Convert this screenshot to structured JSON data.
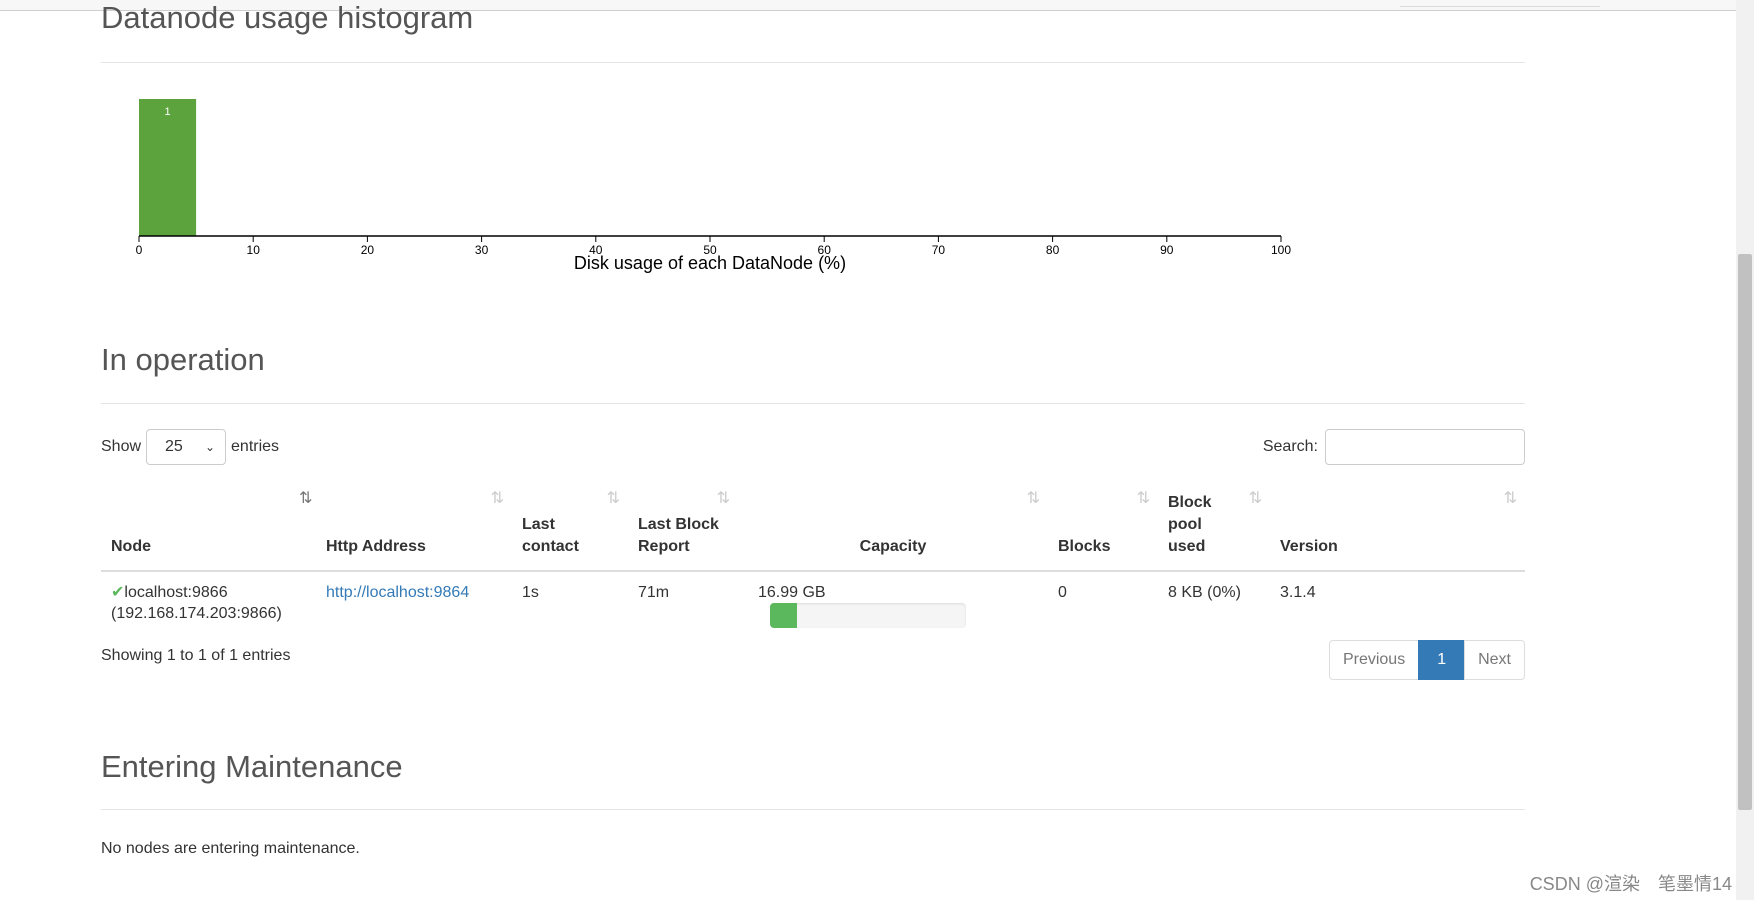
{
  "histogram": {
    "title": "Datanode usage histogram",
    "chart_data": {
      "type": "bar",
      "title": "",
      "xlabel": "Disk usage of each DataNode (%)",
      "ylabel": "",
      "xlim": [
        0,
        100
      ],
      "x_ticks": [
        "0",
        "10",
        "20",
        "30",
        "40",
        "50",
        "60",
        "70",
        "80",
        "90",
        "100"
      ],
      "bins": [
        {
          "x0": 0,
          "x1": 5,
          "count": 1
        }
      ],
      "bar_color": "#5ca33e",
      "grid": false
    }
  },
  "in_operation": {
    "title": "In operation",
    "show_label": "Show",
    "entries_label": "entries",
    "page_size": "25",
    "search_label": "Search:",
    "search_value": "",
    "columns": [
      "Node",
      "Http Address",
      "Last contact",
      "Last Block Report",
      "Capacity",
      "Blocks",
      "Block pool used",
      "Version"
    ],
    "rows": [
      {
        "node_name": "localhost:9866",
        "node_addr": "(192.168.174.203:9866)",
        "http": "http://localhost:9864",
        "last_contact": "1s",
        "last_block_report": "71m",
        "capacity_text": "16.99 GB",
        "capacity_used_fraction": 0.14,
        "blocks": "0",
        "block_pool_used": "8 KB (0%)",
        "version": "3.1.4"
      }
    ],
    "info": "Showing 1 to 1 of 1 entries",
    "pager": {
      "previous": "Previous",
      "current": "1",
      "next": "Next"
    }
  },
  "maintenance": {
    "title": "Entering Maintenance",
    "message": "No nodes are entering maintenance."
  },
  "watermark": "CSDN @渲染　笔墨情14",
  "colors": {
    "accent": "#337ab7",
    "success": "#5cb85c"
  }
}
